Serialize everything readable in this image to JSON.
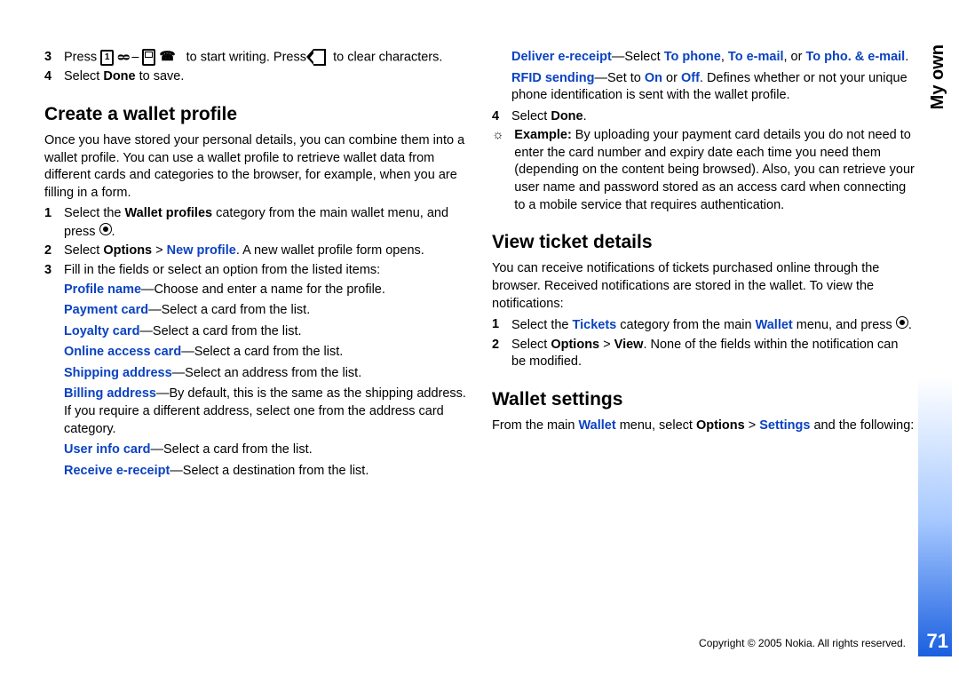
{
  "side_label": "My own",
  "page_number": "71",
  "copyright": "Copyright © 2005 Nokia. All rights reserved.",
  "left": {
    "step3_a": "Press",
    "step3_b": "to start writing. Press",
    "step3_c": "to clear characters.",
    "step4_a": "Select ",
    "step4_done": "Done",
    "step4_b": " to save.",
    "h_create": "Create a wallet profile",
    "create_intro": "Once you have stored your personal details, you can combine them into a wallet profile. You can use a wallet profile to retrieve wallet data from different cards and categories to the browser, for example, when you are filling in a form.",
    "c1_a": "Select the ",
    "c1_link": "Wallet profiles",
    "c1_b": " category from the main wallet menu, and press ",
    "c2_a": "Select ",
    "c2_opt": "Options",
    "c2_gt": " > ",
    "c2_new": "New profile",
    "c2_b": ". A new wallet profile form opens.",
    "c3": "Fill in the fields or select an option from the listed items:",
    "pn_l": "Profile name",
    "pn_t": "—Choose and enter a name for the profile.",
    "pc_l": "Payment card",
    "pc_t": "—Select a card from the list.",
    "lc_l": "Loyalty card",
    "lc_t": "—Select a card from the list.",
    "oac_l": "Online access card",
    "oac_t": "—Select a card from the list.",
    "sa_l": "Shipping address",
    "sa_t": "—Select an address from the list.",
    "ba_l": "Billing address",
    "ba_t": "—By default, this is the same as the shipping address. If you require a different address, select one from the address card category.",
    "uic_l": "User info card",
    "uic_t": "—Select a card from the list.",
    "re_l": "Receive e-receipt",
    "re_t": "—Select a destination from the list."
  },
  "right": {
    "de_l": "Deliver e-receipt",
    "de_t1": "—Select ",
    "de_tp": "To phone",
    "de_c1": ", ",
    "de_te": "To e-mail",
    "de_c2": ", or ",
    "de_tpe": "To pho. & e-mail",
    "de_dot": ".",
    "rf_l": "RFID sending",
    "rf_t1": "—Set to ",
    "rf_on": "On",
    "rf_or": " or ",
    "rf_off": "Off",
    "rf_t2": ". Defines whether or not your unique phone identification is sent with the wallet profile.",
    "r4_a": "Select ",
    "r4_done": "Done",
    "r4_b": ".",
    "ex_b": "Example:",
    "ex_t": " By uploading your payment card details you do not need to enter the card number and expiry date each time you need them (depending on the content being browsed). Also, you can retrieve your user name and password stored as an access card when connecting to a mobile service that requires authentication.",
    "h_view": "View ticket details",
    "view_intro": "You can receive notifications of tickets purchased online through the browser. Received notifications are stored in the wallet. To view the notifications:",
    "v1_a": "Select the ",
    "v1_tk": "Tickets",
    "v1_b": " category from the main ",
    "v1_w": "Wallet",
    "v1_c": " menu, and press ",
    "v2_a": "Select ",
    "v2_opt": "Options",
    "v2_gt": " > ",
    "v2_view": "View",
    "v2_b": ". None of the fields within the notification can be modified.",
    "h_ws": "Wallet settings",
    "ws_a": "From the main ",
    "ws_w": "Wallet",
    "ws_b": " menu, select ",
    "ws_opt": "Options",
    "ws_gt": " > ",
    "ws_set": "Settings",
    "ws_c": " and the following:"
  }
}
